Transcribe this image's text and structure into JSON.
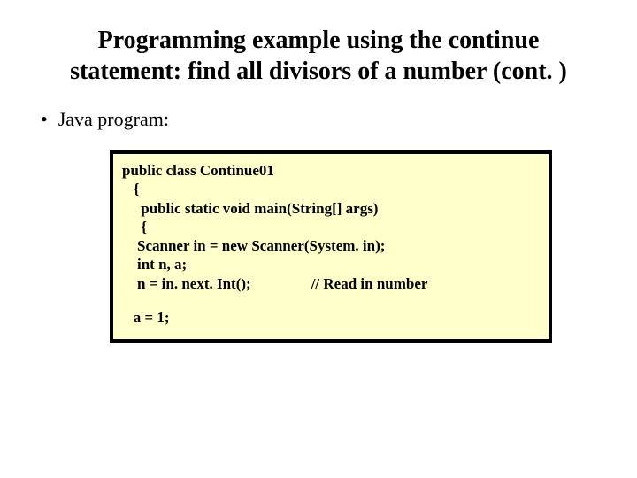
{
  "title": "Programming example using the continue statement: find all divisors of a number (cont. )",
  "bullet": "Java program:",
  "code": {
    "l1": "public class Continue01",
    "l2": "   {",
    "l3": "     public static void main(String[] args)",
    "l4": "     {",
    "l5": "    Scanner in = new Scanner(System. in);",
    "l6": "    int n, a;",
    "l7a": "    n = in. next. Int();",
    "l7b": "// Read in number",
    "l8": "   a = 1;"
  }
}
